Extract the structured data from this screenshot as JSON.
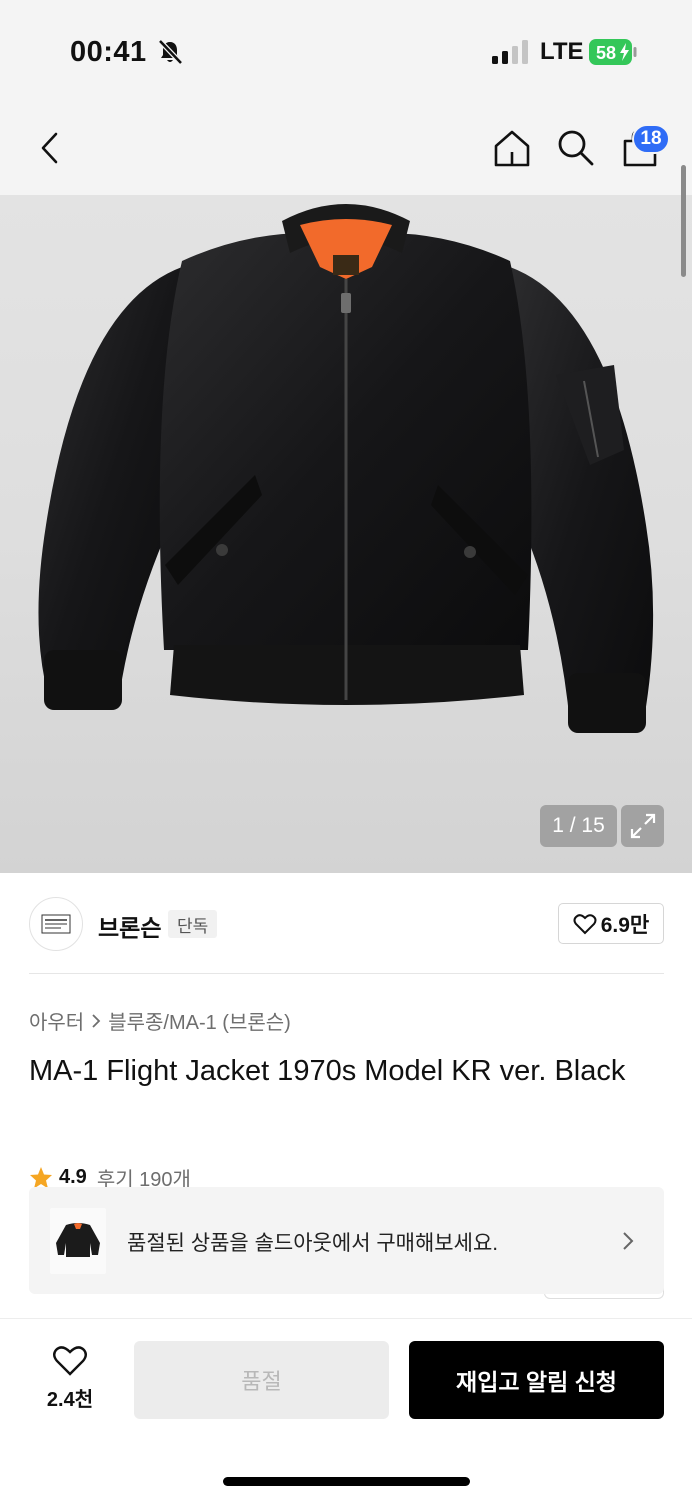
{
  "status_bar": {
    "time": "00:41",
    "network": "LTE",
    "battery": "58"
  },
  "nav": {
    "cart_count": "18"
  },
  "gallery": {
    "counter": "1 / 15"
  },
  "brand": {
    "name": "브론슨",
    "tag": "단독",
    "likes": "6.9만"
  },
  "breadcrumb": {
    "category": "아우터",
    "subcategory": "블루종/MA-1 (브론슨)"
  },
  "product": {
    "title": "MA-1 Flight Jacket 1970s Model KR ver. Black",
    "rating": "4.9",
    "review_label": "후기 190개"
  },
  "soldout_banner": {
    "text": "품절된 상품을 솔드아웃에서 구매해보세요."
  },
  "bottom_bar": {
    "wish_count": "2.4천",
    "soldout_label": "품절",
    "restock_label": "재입고 알림 신청"
  },
  "colors": {
    "accent_badge": "#2f6cf6",
    "battery_green": "#34c759",
    "star": "#f5a623",
    "cta_black": "#000000",
    "jacket_lining": "#f26a2b"
  },
  "icons": [
    "bell-slash-icon",
    "signal-icon",
    "battery-icon",
    "back-arrow-icon",
    "home-icon",
    "search-icon",
    "cart-icon",
    "expand-icon",
    "heart-icon",
    "star-icon",
    "chevron-right-icon"
  ]
}
